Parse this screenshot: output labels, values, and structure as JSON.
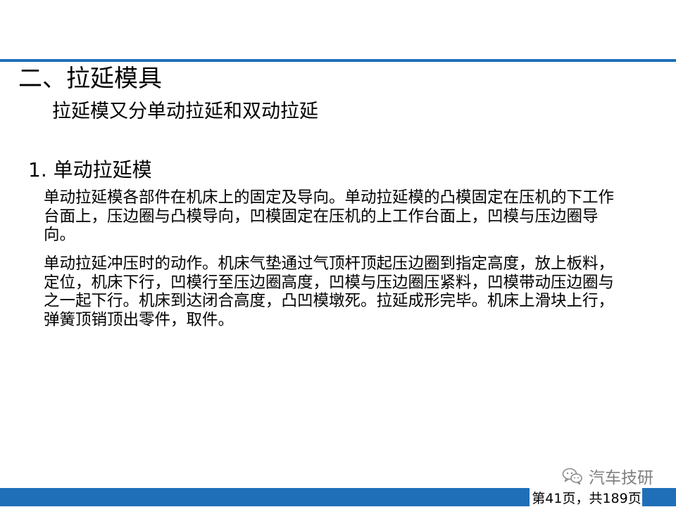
{
  "slide": {
    "title": "二、拉延模具",
    "subtitle": "拉延模又分单动拉延和双动拉延",
    "section_heading": "1. 单动拉延模",
    "paragraphs": [
      "单动拉延模各部件在机床上的固定及导向。单动拉延模的凸模固定在压机的下工作台面上，压边圈与凸模导向，凹模固定在压机的上工作台面上，凹模与压边圈导向。",
      "单动拉延冲压时的动作。机床气垫通过气顶杆顶起压边圈到指定高度，放上板料，定位，机床下行，凹模行至压边圈高度，凹模与压边圈压紧料，凹模带动压边圈与之一起下行。机床到达闭合高度，凸凹模墩死。拉延成形完毕。机床上滑块上行，弹簧顶销顶出零件，取件。"
    ]
  },
  "watermark": {
    "icon": "wechat-icon",
    "text": "汽车技研"
  },
  "footer": {
    "page_indicator": "第41页，共189页"
  },
  "colors": {
    "accent": "#1f6fb8",
    "watermark": "#7f7f7f"
  }
}
